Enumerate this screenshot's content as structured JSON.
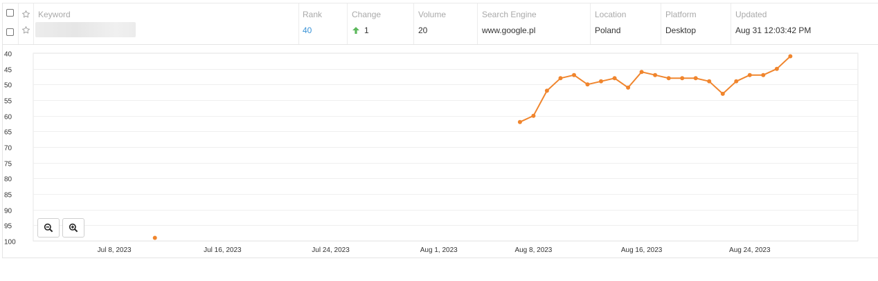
{
  "table": {
    "columns": {
      "keyword": "Keyword",
      "rank": "Rank",
      "change": "Change",
      "volume": "Volume",
      "search_engine": "Search Engine",
      "location": "Location",
      "platform": "Platform",
      "updated": "Updated"
    },
    "row": {
      "rank": "40",
      "change": "1",
      "change_direction": "up",
      "volume": "20",
      "search_engine": "www.google.pl",
      "location": "Poland",
      "platform": "Desktop",
      "updated": "Aug 31 12:03:42 PM"
    },
    "icons": {
      "star": "star-outline-icon",
      "change_up": "arrow-up-icon"
    },
    "colors": {
      "rank_link": "#3a93d6",
      "change_up": "#5cb85c",
      "line": "#f0852d"
    }
  },
  "chart_data": {
    "type": "line",
    "y_axis_inverted": true,
    "ylim": [
      40,
      100
    ],
    "yticks": [
      "40",
      "45",
      "50",
      "55",
      "60",
      "65",
      "70",
      "75",
      "80",
      "85",
      "90",
      "95",
      "100"
    ],
    "xlim": [
      "2023-07-02",
      "2023-09-01"
    ],
    "xticks": [
      {
        "date": "2023-07-08",
        "label": "Jul 8, 2023"
      },
      {
        "date": "2023-07-16",
        "label": "Jul 16, 2023"
      },
      {
        "date": "2023-07-24",
        "label": "Jul 24, 2023"
      },
      {
        "date": "2023-08-01",
        "label": "Aug 1, 2023"
      },
      {
        "date": "2023-08-08",
        "label": "Aug 8, 2023"
      },
      {
        "date": "2023-08-16",
        "label": "Aug 16, 2023"
      },
      {
        "date": "2023-08-24",
        "label": "Aug 24, 2023"
      }
    ],
    "grid": true,
    "series": [
      {
        "points": [
          {
            "date": "2023-07-11",
            "rank": 99
          }
        ]
      },
      {
        "points": [
          {
            "date": "2023-08-07",
            "rank": 62
          },
          {
            "date": "2023-08-08",
            "rank": 60
          },
          {
            "date": "2023-08-09",
            "rank": 52
          },
          {
            "date": "2023-08-10",
            "rank": 48
          },
          {
            "date": "2023-08-11",
            "rank": 47
          },
          {
            "date": "2023-08-12",
            "rank": 50
          },
          {
            "date": "2023-08-13",
            "rank": 49
          },
          {
            "date": "2023-08-14",
            "rank": 48
          },
          {
            "date": "2023-08-15",
            "rank": 51
          },
          {
            "date": "2023-08-16",
            "rank": 46
          },
          {
            "date": "2023-08-17",
            "rank": 47
          },
          {
            "date": "2023-08-18",
            "rank": 48
          },
          {
            "date": "2023-08-19",
            "rank": 48
          },
          {
            "date": "2023-08-20",
            "rank": 48
          },
          {
            "date": "2023-08-21",
            "rank": 49
          },
          {
            "date": "2023-08-22",
            "rank": 53
          },
          {
            "date": "2023-08-23",
            "rank": 49
          },
          {
            "date": "2023-08-24",
            "rank": 47
          },
          {
            "date": "2023-08-25",
            "rank": 47
          },
          {
            "date": "2023-08-26",
            "rank": 45
          },
          {
            "date": "2023-08-27",
            "rank": 41
          }
        ]
      }
    ]
  },
  "zoom": {
    "out_icon": "zoom-out-icon",
    "in_icon": "zoom-in-icon"
  }
}
